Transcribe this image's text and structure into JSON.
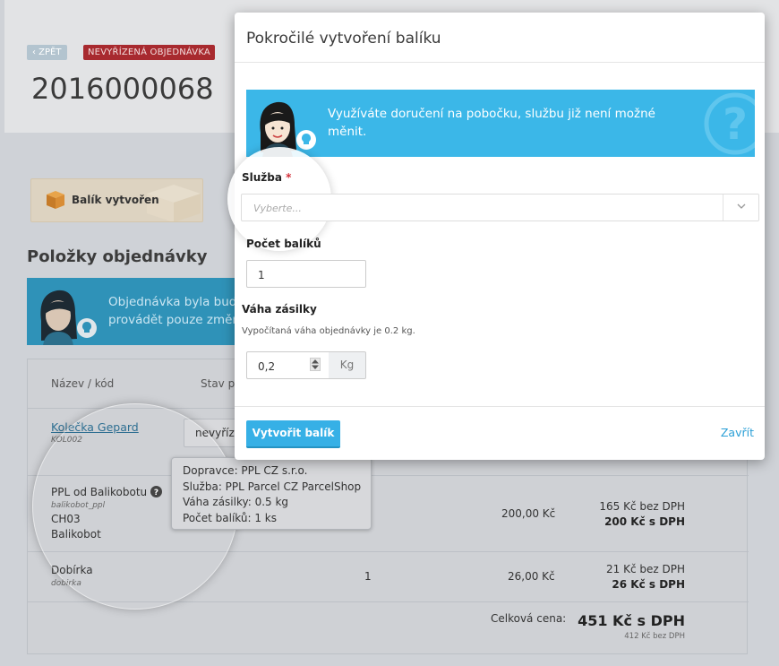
{
  "header": {
    "back_label": "‹ ZPĚT",
    "status_badge": "NEVYŘÍZENÁ OBJEDNÁVKA",
    "order_number": "2016000068"
  },
  "package_card": {
    "label": "Balík vytvořen"
  },
  "items_section": {
    "title": "Položky objednávky",
    "info_text_line1": "Objednávka byla bud",
    "info_text_line2": "provádět pouze změn"
  },
  "table": {
    "col_name": "Název / kód",
    "col_state": "Stav p",
    "rows": [
      {
        "name": "Kolečka Gepard",
        "code": "KOL002",
        "state": "nevyřízen"
      },
      {
        "name": "PPL od Balikobotu",
        "code": "balikobot_ppl",
        "extra1": "CH03",
        "extra2": "Balikobot",
        "price": "200,00 Kč",
        "net": "165 Kč bez DPH",
        "gross": "200 Kč s DPH"
      },
      {
        "name": "Dobírka",
        "code": "dobirka",
        "qty": "1",
        "price": "26,00 Kč",
        "net": "21 Kč bez DPH",
        "gross": "26 Kč s DPH"
      }
    ],
    "total_label": "Celková cena:",
    "total_gross": "451 Kč s DPH",
    "total_net": "412 Kč bez DPH"
  },
  "tooltip": {
    "line1": "Dopravce: PPL CZ s.r.o.",
    "line2": "Služba: PPL Parcel CZ ParcelShop",
    "line3": "Váha zásilky: 0.5 kg",
    "line4": "Počet balíků: 1 ks"
  },
  "modal": {
    "title": "Pokročilé vytvoření balíku",
    "info_line1": "Využíváte doručení na pobočku, službu již není možné",
    "info_line2": "měnit.",
    "service_label": "Služba",
    "service_required": "*",
    "service_placeholder": "Vyberte...",
    "count_label": "Počet balíků",
    "count_value": "1",
    "weight_label": "Váha zásilky",
    "weight_hint": "Vypočítaná váha objednávky je 0.2 kg.",
    "weight_value": "0,2",
    "weight_unit": "Kg",
    "create_button": "Vytvořit balík",
    "close_link": "Zavřít"
  },
  "colors": {
    "info_blue": "#3bb7e8",
    "primary_button": "#36b0e6",
    "badge_red": "#a82a2f"
  }
}
